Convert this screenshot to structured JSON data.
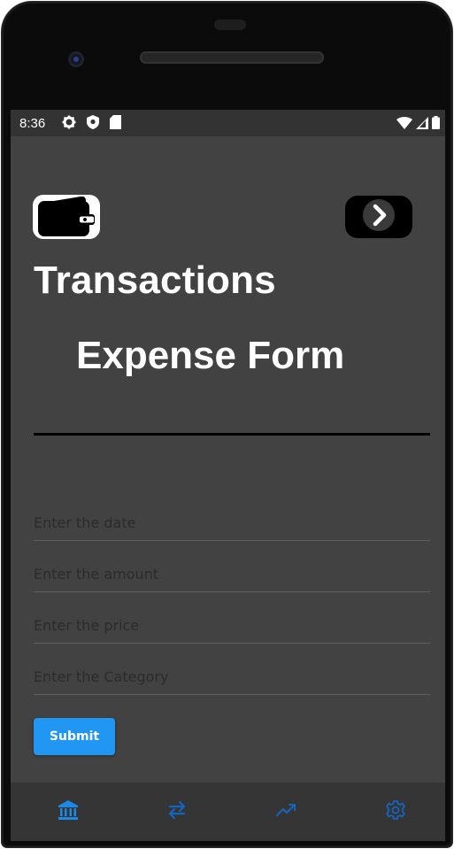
{
  "status_bar": {
    "time": "8:36",
    "left_icons": [
      "gear-icon",
      "shield-icon",
      "sd-card-icon"
    ],
    "right_icons": [
      "wifi-icon",
      "signal-icon",
      "battery-icon"
    ]
  },
  "header": {
    "wallet_icon": "wallet-icon",
    "next_icon": "chevron-right-icon",
    "title": "Transactions"
  },
  "form": {
    "title": "Expense Form",
    "fields": [
      {
        "placeholder": "Enter the date",
        "value": ""
      },
      {
        "placeholder": "Enter the amount",
        "value": ""
      },
      {
        "placeholder": "Enter the price",
        "value": ""
      },
      {
        "placeholder": "Enter the Category",
        "value": ""
      }
    ],
    "submit_label": "Submit"
  },
  "bottom_nav": {
    "items": [
      {
        "icon": "bank-icon",
        "active": true
      },
      {
        "icon": "transfer-icon",
        "active": false
      },
      {
        "icon": "trending-up-icon",
        "active": false
      },
      {
        "icon": "settings-icon",
        "active": false
      }
    ]
  },
  "colors": {
    "background": "#424242",
    "status_bar": "#333333",
    "nav_bar": "#353535",
    "accent": "#2196f3",
    "nav_active": "#1e88e5",
    "nav_inactive": "#1565c0"
  }
}
